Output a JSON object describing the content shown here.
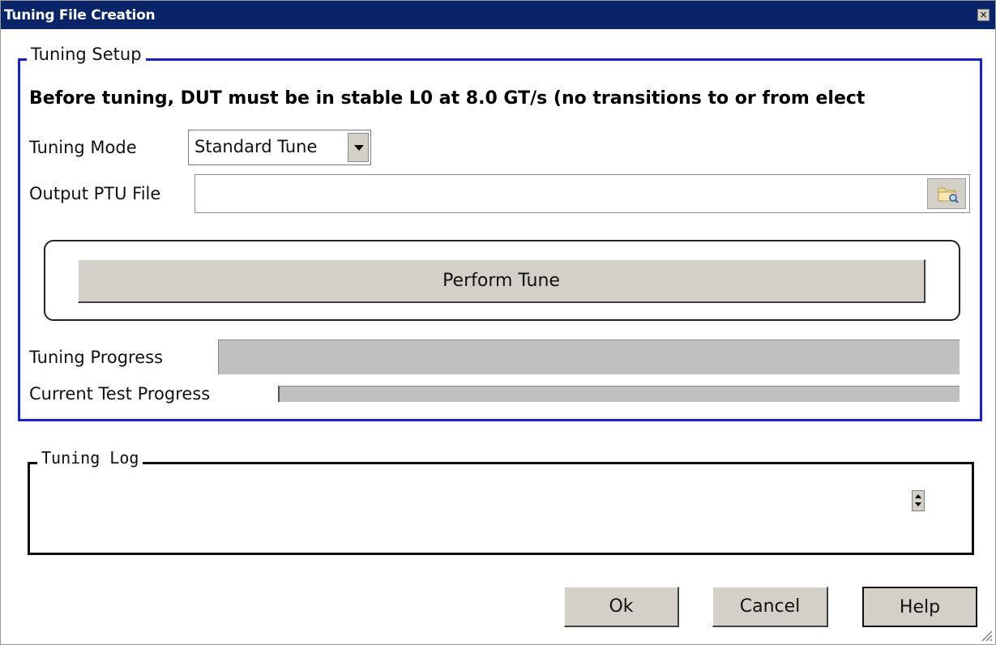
{
  "window": {
    "title": "Tuning File Creation",
    "close_glyph": "×"
  },
  "setup": {
    "legend": "Tuning Setup",
    "warning": "Before tuning, DUT must be in stable L0 at 8.0 GT/s (no transitions to or from elect",
    "mode_label": "Tuning Mode",
    "mode_value": "Standard Tune",
    "output_label": "Output PTU File",
    "output_value": "",
    "perform_button": "Perform Tune",
    "tuning_progress_label": "Tuning Progress",
    "tuning_progress_value": 0,
    "current_progress_label": "Current Test Progress",
    "current_progress_value": 0
  },
  "log": {
    "legend": "Tuning Log"
  },
  "buttons": {
    "ok": "Ok",
    "cancel": "Cancel",
    "help": "Help"
  },
  "colors": {
    "title_bar": "#0a246a",
    "setup_border": "#1a1ae0",
    "button_face": "#d4d0c8",
    "progress_track": "#c0c0c0"
  },
  "icons": {
    "browse": "folder-browse-icon",
    "close": "close-icon",
    "dropdown": "chevron-down-icon",
    "spinner": "spinner-icon",
    "resize": "resize-grip-icon"
  }
}
